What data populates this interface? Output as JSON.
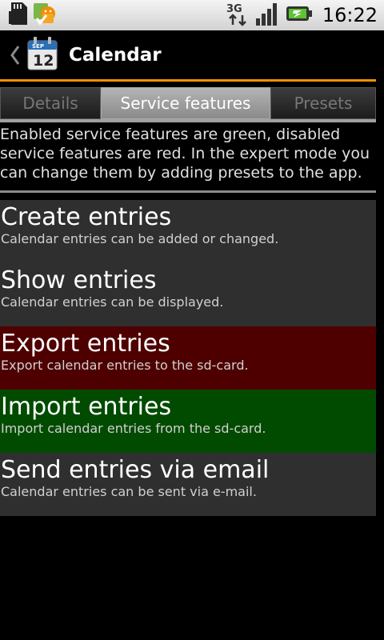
{
  "status_bar": {
    "time": "16:22",
    "network_type": "3G",
    "icons": [
      "sd-card-icon",
      "android-icon",
      "3g-data-icon",
      "signal-icon",
      "battery-charging-icon"
    ]
  },
  "title_bar": {
    "title": "Calendar",
    "calendar_icon_month": "SEP",
    "calendar_icon_day": "12"
  },
  "tabs": [
    {
      "label": "Details",
      "selected": false
    },
    {
      "label": "Service features",
      "selected": true
    },
    {
      "label": "Presets",
      "selected": false
    }
  ],
  "description": "Enabled service features are green, disabled service features are red. In the expert mode you can change them by adding presets to the app.",
  "features": [
    {
      "title": "Create entries",
      "subtitle": "Calendar entries can be added or changed.",
      "status_color": "#2f2f2f"
    },
    {
      "title": "Show entries",
      "subtitle": "Calendar entries can be displayed.",
      "status_color": "#2f2f2f"
    },
    {
      "title": "Export entries",
      "subtitle": "Export calendar entries to the sd-card.",
      "status_color": "#4e0000"
    },
    {
      "title": "Import entries",
      "subtitle": "Import calendar entries from the sd-card.",
      "status_color": "#004b00"
    },
    {
      "title": "Send entries via email",
      "subtitle": "Calendar entries can be sent via e-mail.",
      "status_color": "#2f2f2f"
    }
  ],
  "colors": {
    "accent": "#f39200",
    "enabled": "#004b00",
    "disabled": "#4e0000"
  }
}
